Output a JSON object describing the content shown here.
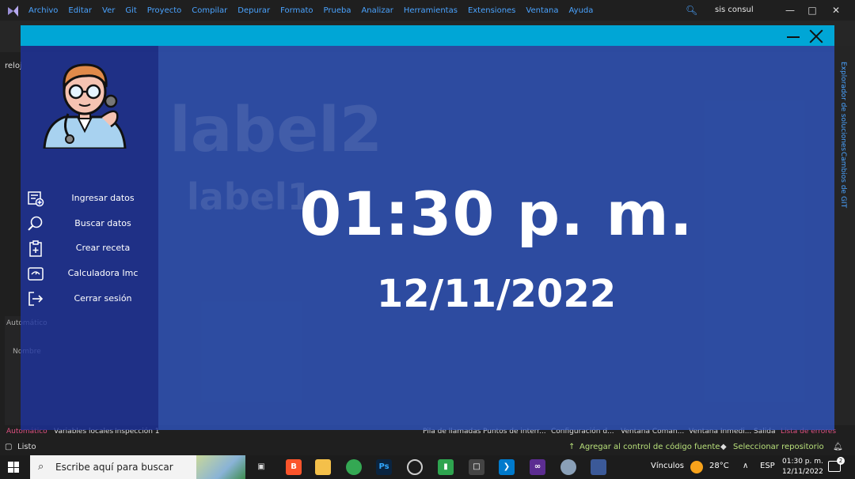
{
  "vs": {
    "menu": [
      "Archivo",
      "Editar",
      "Ver",
      "Git",
      "Proyecto",
      "Compilar",
      "Depurar",
      "Formato",
      "Prueba",
      "Analizar",
      "Herramientas",
      "Extensiones",
      "Ventana",
      "Ayuda"
    ],
    "title": "sis consul",
    "left_tab": "reloj",
    "right_tabs": [
      "Explorador de soluciones",
      "Cambios de GIT"
    ],
    "panel_label": "Automático",
    "panel_label2": "Nombre",
    "bottom_tabs": {
      "automatico": "Automático",
      "variables": "Variables locales",
      "inspeccion": "Inspección 1",
      "pila": "Pila de llamadas",
      "puntos": "Puntos de interr...",
      "config": "Configuración d...",
      "ventana_comandos": "Ventana Coman...",
      "ventana_inmediato": "Ventana Inmedi...",
      "salida": "Salida",
      "errores": "Lista de errores"
    },
    "status": {
      "listo": "Listo",
      "git": "Agregar al control de código fuente",
      "repo": "Seleccionar repositorio"
    }
  },
  "taskbar": {
    "search_placeholder": "Escribe aquí para buscar",
    "vinculos": "Vínculos",
    "temperature": "28°C",
    "lang": "ESP",
    "time": "01:30 p. m.",
    "date": "12/11/2022",
    "notifications": "2"
  },
  "app": {
    "ghost_label2": "label2",
    "ghost_label1": "label1",
    "clock_time": "01:30 p. m.",
    "clock_date": "12/11/2022",
    "menu": [
      {
        "label": "Ingresar datos",
        "icon": "register-form-icon"
      },
      {
        "label": "Buscar datos",
        "icon": "search-icon"
      },
      {
        "label": "Crear receta",
        "icon": "clipboard-plus-icon"
      },
      {
        "label": "Calculadora Imc",
        "icon": "scale-icon"
      },
      {
        "label": "Cerrar sesión",
        "icon": "logout-icon"
      }
    ]
  },
  "colors": {
    "titlebar": "#00a6d6",
    "sidebar": "#1c32a0",
    "main": "#2e54be",
    "vs_accent": "#4aa3ff"
  }
}
